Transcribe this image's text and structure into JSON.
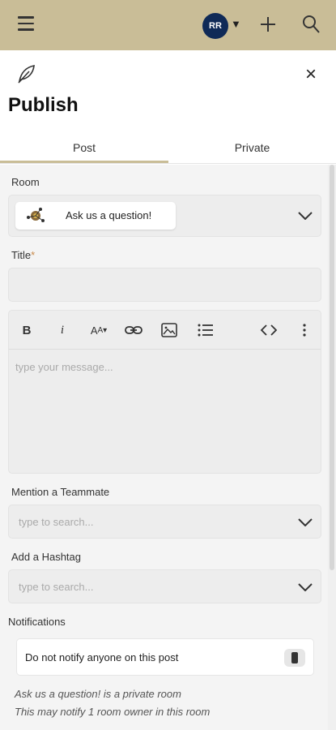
{
  "header": {
    "avatar_initials": "RR",
    "accent_color": "#c9bd97",
    "avatar_color": "#0f2a57"
  },
  "panel": {
    "title": "Publish",
    "tabs": [
      {
        "label": "Post",
        "active": true
      },
      {
        "label": "Private",
        "active": false
      }
    ]
  },
  "form": {
    "room_label": "Room",
    "room_selected": "Ask us a question!",
    "title_label": "Title",
    "title_required_mark": "*",
    "title_value": "",
    "editor_placeholder": "type your message...",
    "toolbar_icons": [
      "bold-icon",
      "italic-icon",
      "font-size-icon",
      "link-icon",
      "image-icon",
      "list-icon",
      "code-icon",
      "more-icon"
    ],
    "mention_label": "Mention a Teammate",
    "mention_placeholder": "type to search...",
    "hashtag_label": "Add a Hashtag",
    "hashtag_placeholder": "type to search...",
    "notifications_label": "Notifications",
    "notify_option": "Do not notify anyone on this post",
    "note_line1": "Ask us a question! is a private room",
    "note_line2": "This may notify 1 room owner in this room"
  }
}
